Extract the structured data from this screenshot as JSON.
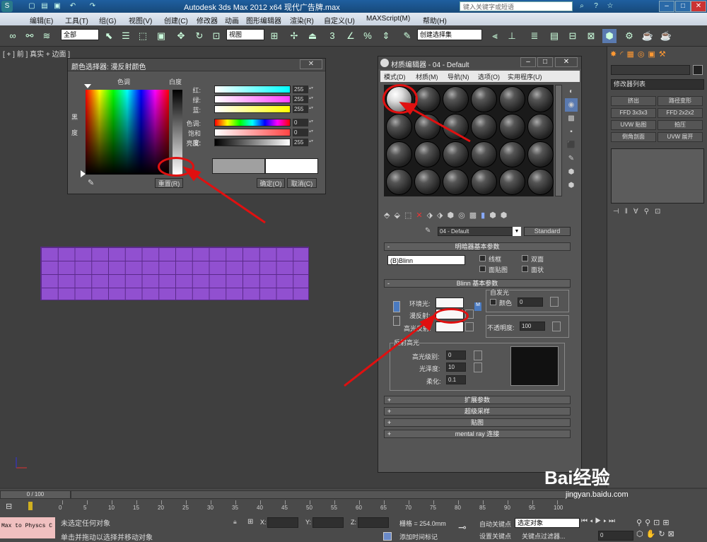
{
  "app": {
    "title": "Autodesk 3ds Max  2012 x64      现代广告牌.max",
    "search_placeholder": "键入关键字或短语"
  },
  "menu": [
    "编辑(E)",
    "工具(T)",
    "组(G)",
    "视图(V)",
    "创建(C)",
    "修改器",
    "动画",
    "图形编辑器",
    "渲染(R)",
    "自定义(U)",
    "MAXScript(M)",
    "帮助(H)"
  ],
  "toolbar": {
    "selection_filter": "全部",
    "view_dropdown": "视图",
    "create_selection_set": "创建选择集",
    "snap_3": "3"
  },
  "viewport": {
    "label": "[ + ] 前 ] 真实 + 边面 ]"
  },
  "color_picker": {
    "title": "颜色选择器: 漫反射颜色",
    "close": "✕",
    "hue_label": "色调",
    "white_label": "白度",
    "black_label": "黑",
    "black_label2": "度",
    "sliders": [
      {
        "label": "红:",
        "value": "255",
        "color": "#00ffff"
      },
      {
        "label": "绿:",
        "value": "255",
        "color": "#ff40ff"
      },
      {
        "label": "蓝:",
        "value": "255",
        "color": "#ffff00"
      },
      {
        "label": "色调:",
        "value": "0",
        "color": "rainbow"
      },
      {
        "label": "饱和度:",
        "value": "0",
        "color": "#ff4444"
      },
      {
        "label": "亮度:",
        "value": "255",
        "color": "gray"
      }
    ],
    "reset": "重置(R)",
    "ok": "确定(O)",
    "cancel": "取消(C)"
  },
  "material_editor": {
    "title": "材质编辑器 - 04 - Default",
    "menu": [
      "模式(D)",
      "材质(M)",
      "导航(N)",
      "选项(O)",
      "实用程序(U)"
    ],
    "material_name": "04 - Default",
    "material_type": "Standard",
    "shader_rollout": "明暗器基本参数",
    "shader": "(B)Blinn",
    "wire": "线框",
    "two_sided": "双面",
    "face_map": "面贴图",
    "faceted": "面状",
    "blinn_rollout": "Blinn 基本参数",
    "self_illum": "自发光",
    "color_label": "颜色",
    "self_illum_value": "0",
    "ambient": "环境光:",
    "diffuse": "漫反射:",
    "specular": "高光反射:",
    "opacity_label": "不透明度:",
    "opacity": "100",
    "spec_highlights": "反射高光",
    "spec_level_label": "高光级别:",
    "spec_level": "0",
    "gloss_label": "光泽度:",
    "gloss": "10",
    "soften_label": "柔化:",
    "soften": "0.1",
    "rollouts": [
      "扩展参数",
      "超级采样",
      "贴图",
      "mental ray 连接"
    ]
  },
  "command_panel": {
    "modifier_list": "修改器列表",
    "buttons": [
      "挤出",
      "路径变形",
      "FFD 3x3x3",
      "FFD 2x2x2",
      "UVW 贴图",
      "拍压",
      "倒角剖面",
      "UVW 展开"
    ]
  },
  "timeline": {
    "frame": "0 / 100",
    "ticks": [
      "0",
      "5",
      "10",
      "15",
      "20",
      "25",
      "30",
      "35",
      "40",
      "45",
      "50",
      "55",
      "60",
      "65",
      "70",
      "75",
      "80",
      "85",
      "90",
      "95",
      "100"
    ]
  },
  "status": {
    "script_listener": "Max to Physcs C",
    "selection": "未选定任何对象",
    "prompt": "单击并拖动以选择并移动对象",
    "x_label": "X:",
    "y_label": "Y:",
    "z_label": "Z:",
    "grid": "栅格 = 254.0mm",
    "add_time_tag": "添加时间标记",
    "auto_key": "自动关键点",
    "selected": "选定对象",
    "set_key": "设置关键点",
    "key_filters": "关键点过滤器...",
    "frame_value": "0"
  },
  "watermark": {
    "brand": "Bai经验",
    "url": "jingyan.baidu.com"
  }
}
